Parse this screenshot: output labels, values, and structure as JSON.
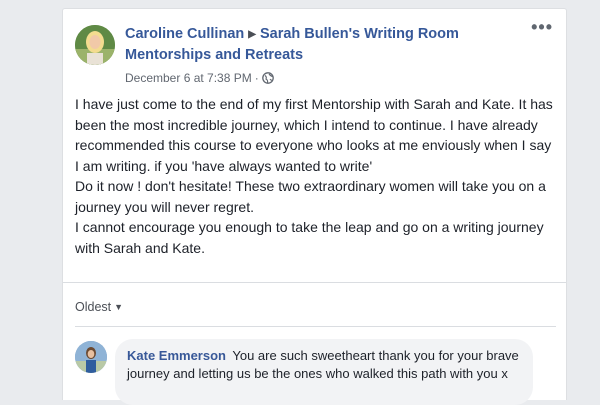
{
  "post": {
    "author": "Caroline Cullinan",
    "group": "Sarah Bullen's Writing Room Mentorships and Retreats",
    "timestamp": "December 6 at 7:38 PM",
    "separator": "·",
    "audience_icon": "globe-icon",
    "more_label": "•••",
    "paragraphs": [
      "I have just come to the end of my first Mentorship with Sarah and Kate. It has been the most incredible journey, which I intend to continue. I have already recommended this course to everyone who looks at me enviously when I say I am writing. if you 'have always wanted to write'",
      "Do it now ! don't hesitate! These two extraordinary women will take you on a journey you will never regret.",
      "I cannot encourage you enough to take the leap and go on a writing journey with Sarah and Kate."
    ]
  },
  "comments": {
    "sort_label": "Oldest",
    "items": [
      {
        "author": "Kate Emmerson",
        "text": "You are such sweetheart thank you for your brave journey and letting us be the ones who walked this path with you x"
      }
    ]
  },
  "colors": {
    "link": "#365899",
    "text": "#1d2129",
    "meta": "#616770",
    "background": "#e9ebee",
    "bubble": "#f2f3f5"
  }
}
